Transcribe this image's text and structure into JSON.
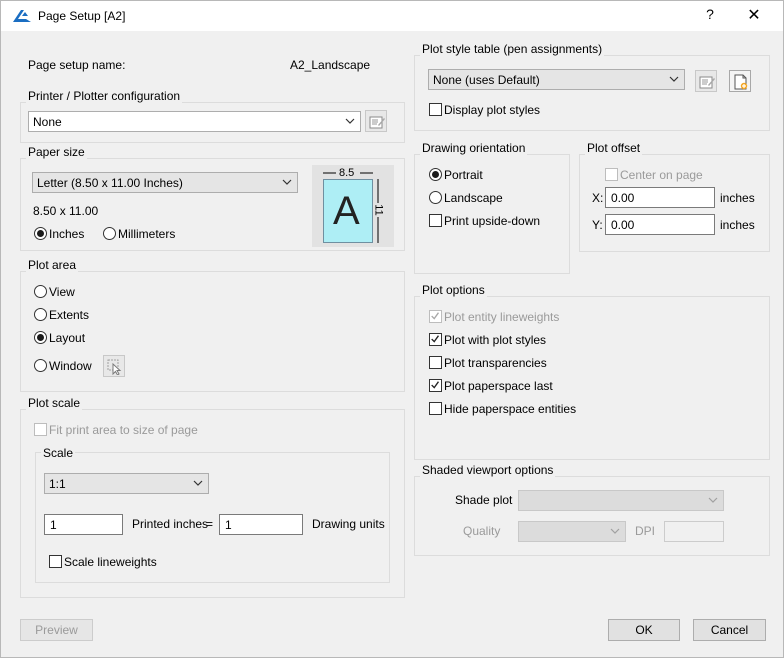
{
  "window": {
    "title": "Page Setup [A2]",
    "help_label": "?",
    "close_label": "✕"
  },
  "setup": {
    "name_label": "Page setup name:",
    "name_value": "A2_Landscape"
  },
  "printer": {
    "group": "Printer / Plotter configuration",
    "value": "None"
  },
  "paper": {
    "group": "Paper size",
    "value": "Letter (8.50 x 11.00 Inches)",
    "dims": "8.50 x 11.00",
    "inches": "Inches",
    "millimeters": "Millimeters",
    "preview_width": "8.5",
    "preview_height": "11",
    "preview_letter": "A"
  },
  "plot_area": {
    "group": "Plot area",
    "view": "View",
    "extents": "Extents",
    "layout": "Layout",
    "window": "Window"
  },
  "plot_scale": {
    "group": "Plot scale",
    "fit": "Fit print area to size of page",
    "scale_group": "Scale",
    "scale_value": "1:1",
    "printed_value": "1",
    "printed_label": "Printed inches",
    "equals": "=",
    "units_value": "1",
    "units_label": "Drawing units",
    "lineweights": "Scale lineweights"
  },
  "plot_style": {
    "group": "Plot style table (pen assignments)",
    "value": "None (uses Default)",
    "display": "Display plot styles"
  },
  "orientation": {
    "group": "Drawing orientation",
    "portrait": "Portrait",
    "landscape": "Landscape",
    "upside_down": "Print upside-down"
  },
  "offset": {
    "group": "Plot offset",
    "center": "Center on page",
    "x_label": "X:",
    "x_value": "0.00",
    "y_label": "Y:",
    "y_value": "0.00",
    "units": "inches"
  },
  "options": {
    "group": "Plot options",
    "entity_lineweights": "Plot entity lineweights",
    "with_styles": "Plot with plot styles",
    "transparencies": "Plot transparencies",
    "paperspace_last": "Plot paperspace last",
    "hide_paperspace": "Hide paperspace entities"
  },
  "shaded": {
    "group": "Shaded viewport options",
    "shade_label": "Shade plot",
    "quality_label": "Quality",
    "dpi_label": "DPI"
  },
  "buttons": {
    "preview": "Preview",
    "ok": "OK",
    "cancel": "Cancel"
  },
  "colors": {
    "accent": "#1b6ec2",
    "paper_preview": "#aeeef5"
  }
}
